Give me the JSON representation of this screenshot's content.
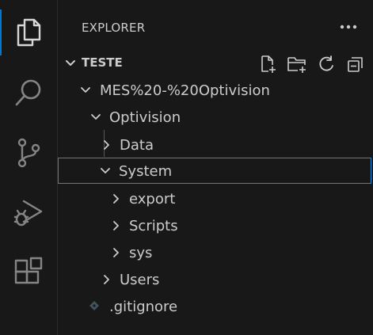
{
  "activity_bar": {
    "icons": [
      "explorer-icon",
      "search-icon",
      "source-control-icon",
      "run-debug-icon",
      "extensions-icon"
    ],
    "active_color": "#0078d4"
  },
  "sidebar": {
    "title": "EXPLORER",
    "more_label": "···",
    "workspace": {
      "title": "TESTE",
      "actions": [
        "new-file-icon",
        "new-folder-icon",
        "refresh-icon",
        "collapse-all-icon"
      ]
    },
    "tree": [
      {
        "label": "MES%20-%20Optivision",
        "type": "folder",
        "expanded": true
      },
      {
        "label": "Optivision",
        "type": "folder",
        "expanded": true
      },
      {
        "label": "Data",
        "type": "folder",
        "expanded": false
      },
      {
        "label": "System",
        "type": "folder",
        "expanded": true,
        "selected": true
      },
      {
        "label": "export",
        "type": "folder",
        "expanded": false
      },
      {
        "label": "Scripts",
        "type": "folder",
        "expanded": false
      },
      {
        "label": "sys",
        "type": "folder",
        "expanded": false
      },
      {
        "label": "Users",
        "type": "folder",
        "expanded": false
      },
      {
        "label": ".gitignore",
        "type": "file"
      }
    ]
  },
  "colors": {
    "background": "#181818",
    "text": "#cccccc",
    "selection_border": "#2488db",
    "icon": "#cccccc"
  }
}
